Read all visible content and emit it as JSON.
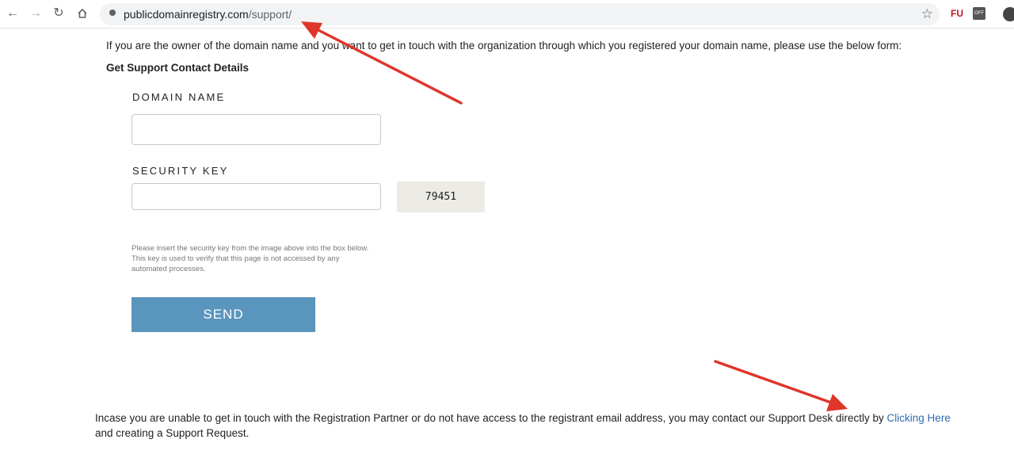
{
  "browser": {
    "url_domain": "publicdomainregistry.com",
    "url_path": "/support/",
    "extensions": [
      "FU",
      "OFF"
    ]
  },
  "page": {
    "intro_text": "If you are the owner of the domain name and you want to get in touch with the organization through which you registered your domain name, please use the below form:",
    "section_title": "Get Support Contact Details",
    "form": {
      "domain_label": "DOMAIN NAME",
      "domain_value": "",
      "security_label": "SECURITY KEY",
      "security_value": "",
      "captcha_text": "79451",
      "help_text": "Please insert the security key from the image above into the box below. This key is used to verify that this page is not accessed by any automated processes.",
      "send_label": "SEND"
    },
    "footer": {
      "text_before": "Incase you are unable to get in touch with the Registration Partner or do not have access to the registrant email address, you may contact our Support Desk directly by ",
      "link_text": "Clicking Here",
      "text_after": " and creating a Support Request."
    }
  },
  "annotation_color": "#e0352b"
}
